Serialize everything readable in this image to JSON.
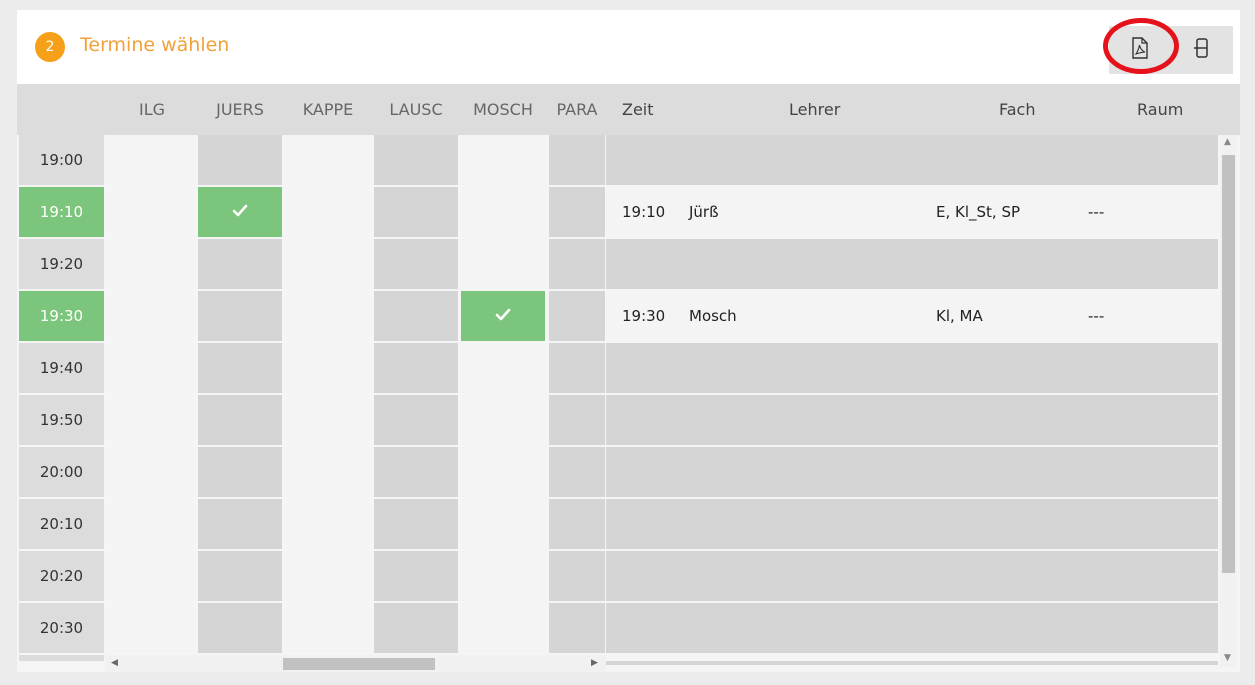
{
  "header": {
    "step_number": "2",
    "title": "Termine wählen",
    "pdf_icon": "pdf-file-icon",
    "layout_icon": "split-layout-icon"
  },
  "teacher_columns": [
    "ILG",
    "JUERS",
    "KAPPE",
    "LAUSC",
    "MOSCH",
    "PARA"
  ],
  "time_slots": [
    "19:00",
    "19:10",
    "19:20",
    "19:30",
    "19:40",
    "19:50",
    "20:00",
    "20:10",
    "20:20",
    "20:30"
  ],
  "selected_times": [
    "19:10",
    "19:30"
  ],
  "bookings": [
    {
      "time": "19:10",
      "teacher_column": "JUERS"
    },
    {
      "time": "19:30",
      "teacher_column": "MOSCH"
    }
  ],
  "appointments_table": {
    "headers": {
      "zeit": "Zeit",
      "lehrer": "Lehrer",
      "fach": "Fach",
      "raum": "Raum"
    },
    "rows": [
      {
        "zeit": "",
        "lehrer": "",
        "fach": "",
        "raum": ""
      },
      {
        "zeit": "19:10",
        "lehrer": "Jürß",
        "fach": "E, Kl_St, SP",
        "raum": "---"
      },
      {
        "zeit": "",
        "lehrer": "",
        "fach": "",
        "raum": ""
      },
      {
        "zeit": "19:30",
        "lehrer": "Mosch",
        "fach": "Kl, MA",
        "raum": "---"
      },
      {
        "zeit": "",
        "lehrer": "",
        "fach": "",
        "raum": ""
      },
      {
        "zeit": "",
        "lehrer": "",
        "fach": "",
        "raum": ""
      },
      {
        "zeit": "",
        "lehrer": "",
        "fach": "",
        "raum": ""
      },
      {
        "zeit": "",
        "lehrer": "",
        "fach": "",
        "raum": ""
      },
      {
        "zeit": "",
        "lehrer": "",
        "fach": "",
        "raum": ""
      },
      {
        "zeit": "",
        "lehrer": "",
        "fach": "",
        "raum": ""
      }
    ]
  },
  "colors": {
    "accent": "#f6a01a",
    "selected_green": "#7cc57c",
    "highlight_ring": "#e5121b"
  }
}
